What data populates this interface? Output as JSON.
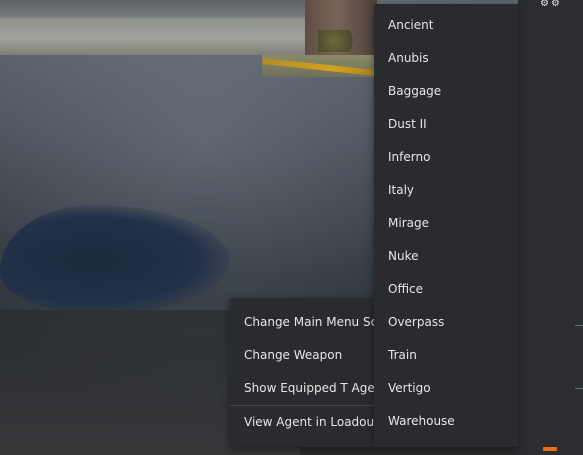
{
  "context_menu": {
    "items": [
      {
        "label": "Change Main Menu Scene"
      },
      {
        "label": "Change Weapon"
      },
      {
        "label": "Show Equipped T Agent"
      },
      {
        "label": "View Agent in Loadout"
      }
    ]
  },
  "scene_submenu": {
    "items": [
      {
        "label": "Ancient"
      },
      {
        "label": "Anubis"
      },
      {
        "label": "Baggage"
      },
      {
        "label": "Dust II"
      },
      {
        "label": "Inferno"
      },
      {
        "label": "Italy"
      },
      {
        "label": "Mirage"
      },
      {
        "label": "Nuke"
      },
      {
        "label": "Office"
      },
      {
        "label": "Overpass"
      },
      {
        "label": "Train"
      },
      {
        "label": "Vertigo"
      },
      {
        "label": "Warehouse"
      }
    ]
  },
  "colors": {
    "menu_background": "#2a2b2e",
    "menu_text": "#e6e6e6",
    "accent": "#e8700f"
  }
}
